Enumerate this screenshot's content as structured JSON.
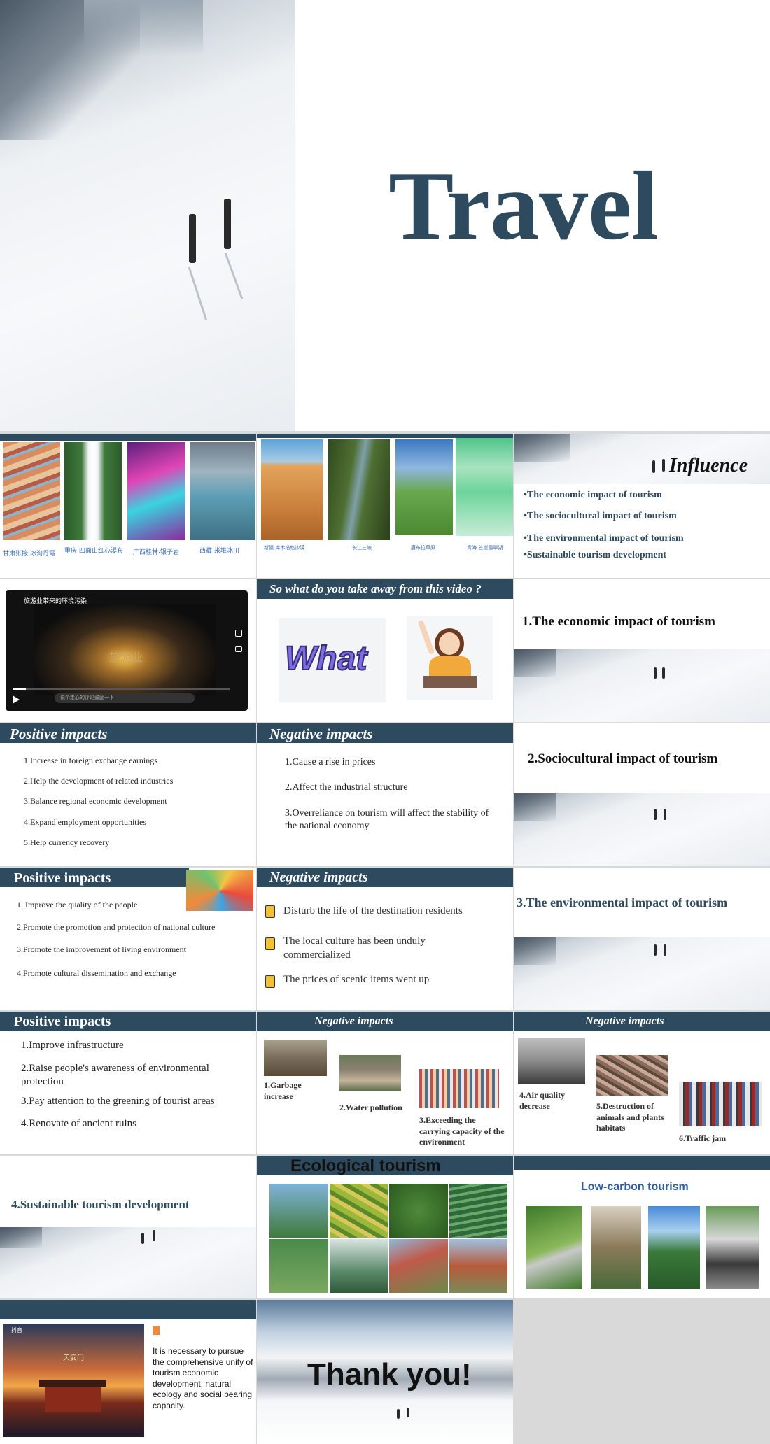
{
  "title_slide": {
    "title": "Travel"
  },
  "china_sights_1": {
    "captions": [
      "甘肃张掖·冰沟丹霞",
      "重庆·四面山红心瀑布",
      "广西桂林·银子岩",
      "西藏·米堆冰川"
    ]
  },
  "china_sights_2": {
    "captions": [
      "新疆·库木塔格沙漠",
      "长江三峡",
      "唐布拉草原",
      "青海·芒崖翡翠湖"
    ]
  },
  "influence": {
    "heading": "Influence",
    "items": [
      "•The economic impact of tourism",
      "•The sociocultural impact of tourism",
      "•The environmental impact of tourism",
      "•Sustainable tourism development"
    ]
  },
  "video_slide": {
    "video_title": "旅游业带来的环境污染",
    "overlay_text": "旅游业",
    "comment_placeholder": "说个走心的评论鼓励一下"
  },
  "question_slide": {
    "heading": "So what do you take away from this video ?",
    "sticker_text": "What"
  },
  "economic_section": {
    "heading": "1.The economic impact of tourism"
  },
  "positive_econ": {
    "heading": "Positive  impacts",
    "items": [
      "1.Increase in foreign exchange earnings",
      "2.Help the development of related industries",
      "3.Balance regional economic development",
      "4.Expand employment opportunities",
      "5.Help currency recovery"
    ]
  },
  "negative_econ": {
    "heading": "Negative  impacts",
    "items": [
      "1.Cause a rise in prices",
      "2.Affect the industrial structure",
      "3.Overreliance on tourism will affect the stability of the national economy"
    ]
  },
  "socio_section": {
    "heading": "2.Sociocultural impact of tourism"
  },
  "positive_socio": {
    "heading": "Positive impacts",
    "items": [
      "1. Improve the quality of the people",
      "2.Promote the promotion and protection of national culture",
      "3.Promote the improvement of living environment",
      "4.Promote cultural dissemination and exchange"
    ]
  },
  "negative_socio": {
    "heading": "Negative  impacts",
    "items": [
      "Disturb the life of the destination residents",
      "The local culture has been unduly commercialized",
      "The prices of scenic items went up"
    ]
  },
  "env_section": {
    "heading": "3.The environmental impact of tourism"
  },
  "positive_env": {
    "heading": "Positive impacts",
    "items": [
      "1.Improve infrastructure",
      "2.Raise people's awareness of environmental protection",
      "3.Pay attention to the greening of tourist areas",
      "4.Renovate of  ancient ruins"
    ]
  },
  "negative_env_1": {
    "heading": "Negative impacts",
    "items": [
      "1.Garbage increase",
      "2.Water pollution",
      "3.Exceeding the carrying capacity of the environment"
    ]
  },
  "negative_env_2": {
    "heading": "Negative impacts",
    "items": [
      "4.Air quality decrease",
      "5.Destruction of animals and plants habitats",
      "6.Traffic jam"
    ]
  },
  "sustain_section": {
    "heading": "4.Sustainable tourism development"
  },
  "eco_tourism": {
    "heading": "Ecological tourism"
  },
  "low_carbon": {
    "heading": "Low-carbon tourism"
  },
  "final_text": {
    "app_name": "抖音",
    "sign_text": "天安门",
    "paragraph": "It is necessary to pursue the comprehensive unity of tourism economic development, natural ecology and social bearing capacity."
  },
  "thanks": {
    "text": "Thank you!"
  },
  "colors": {
    "navy": "#2e4a5e",
    "caption_blue": "#3b6db3",
    "slide_bg": "#ffffff",
    "page_bg": "#d9d9d9"
  }
}
